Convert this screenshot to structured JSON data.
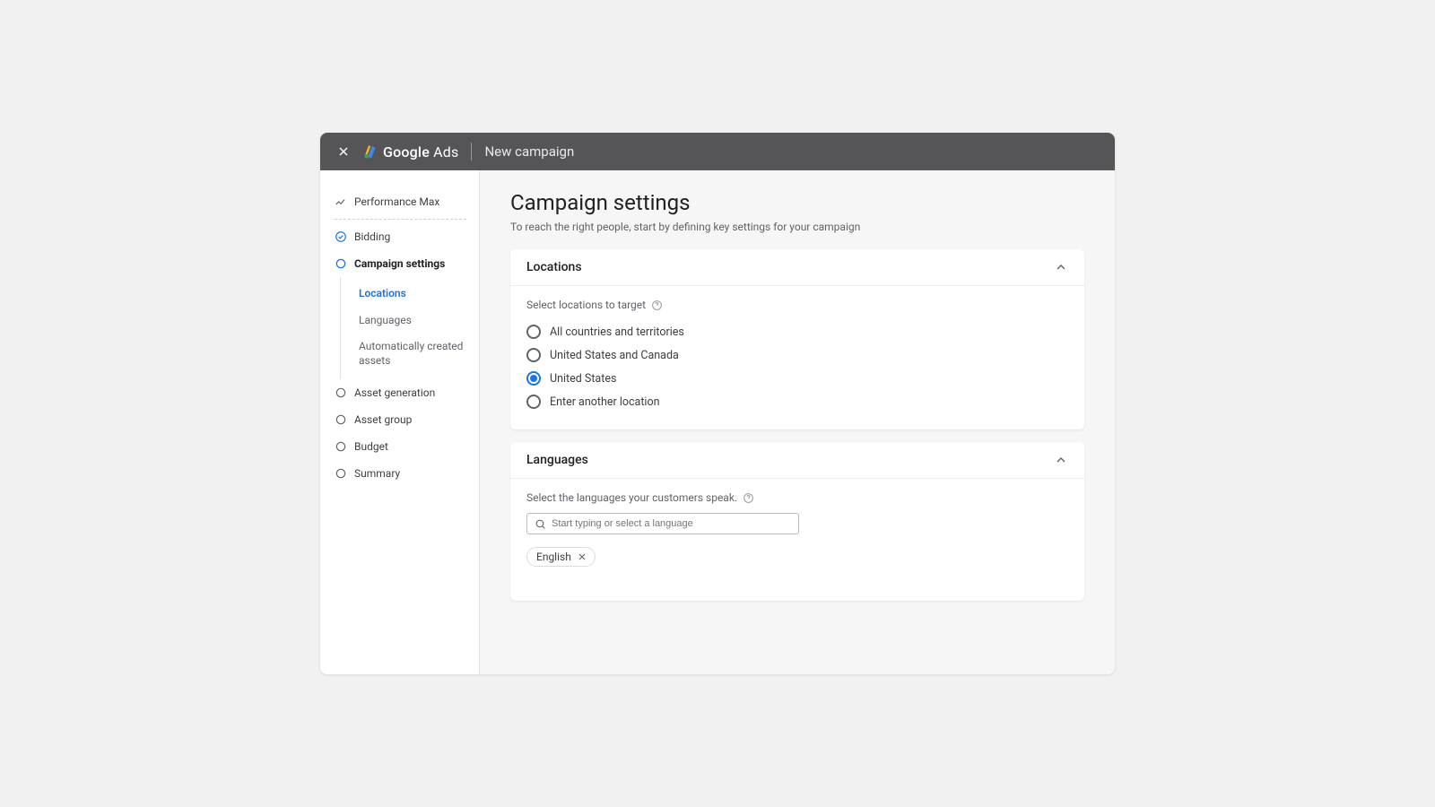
{
  "topbar": {
    "brand_primary": "Google",
    "brand_secondary": "Ads",
    "page_name": "New campaign"
  },
  "sidebar": {
    "steps": [
      {
        "label": "Performance Max",
        "status": "header"
      },
      {
        "label": "Bidding",
        "status": "done"
      },
      {
        "label": "Campaign settings",
        "status": "current"
      },
      {
        "label": "Asset generation",
        "status": "todo"
      },
      {
        "label": "Asset group",
        "status": "todo"
      },
      {
        "label": "Budget",
        "status": "todo"
      },
      {
        "label": "Summary",
        "status": "todo"
      }
    ],
    "substeps": [
      {
        "label": "Locations",
        "active": true
      },
      {
        "label": "Languages",
        "active": false
      },
      {
        "label": "Automatically created assets",
        "active": false
      }
    ]
  },
  "main": {
    "title": "Campaign settings",
    "subtitle": "To reach the right people, start by defining key settings for your campaign",
    "locations": {
      "card_title": "Locations",
      "hint": "Select locations to target",
      "options": [
        {
          "label": "All countries and territories",
          "selected": false
        },
        {
          "label": "United States and Canada",
          "selected": false
        },
        {
          "label": "United States",
          "selected": true
        },
        {
          "label": "Enter another location",
          "selected": false
        }
      ]
    },
    "languages": {
      "card_title": "Languages",
      "hint": "Select the languages your customers speak.",
      "placeholder": "Start typing or select a language",
      "chips": [
        {
          "label": "English"
        }
      ]
    }
  }
}
